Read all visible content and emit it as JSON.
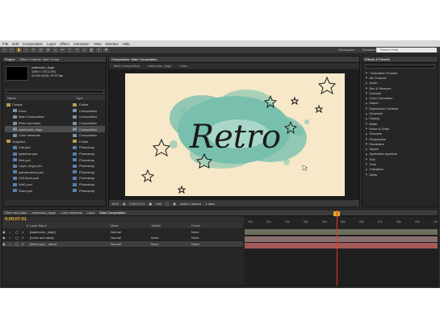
{
  "menu": [
    "File",
    "Edit",
    "Composition",
    "Layer",
    "Effect",
    "Animation",
    "View",
    "Window",
    "Help"
  ],
  "toolbar": {
    "workspace_label": "Workspace:",
    "workspace_value": "Standard",
    "search_placeholder": "Search Help"
  },
  "project_panel": {
    "tabs": [
      "Project",
      "Effect Controls: Main Comp"
    ],
    "item_info": {
      "name": "watercolor_large",
      "line2": "1280 x 720 (1.00)",
      "line3": "Δ 0;00;10;00, 29.97 fps"
    },
    "columns": {
      "name": "Name",
      "type": "Type"
    },
    "items": [
      {
        "name": "Comps",
        "type": "Folder",
        "kind": "folder",
        "label_color": "#b99c4a"
      },
      {
        "name": "Lines",
        "type": "Composition",
        "kind": "comp",
        "label_color": "#7b8fa3"
      },
      {
        "name": "Main Composition",
        "type": "Composition",
        "kind": "comp",
        "label_color": "#7b8fa3"
      },
      {
        "name": "Retro and stars",
        "type": "Composition",
        "kind": "comp",
        "label_color": "#7b8fa3"
      },
      {
        "name": "watercolor_large",
        "type": "Composition",
        "kind": "comp",
        "label_color": "#7b8fa3",
        "selected": true
      },
      {
        "name": "Color elements",
        "type": "Composition",
        "kind": "comp",
        "label_color": "#7b8fa3"
      },
      {
        "name": "Graphics",
        "type": "Folder",
        "kind": "folder",
        "label_color": "#b99c4a"
      },
      {
        "name": "Cell.psd",
        "type": "Photoshop",
        "kind": "file",
        "label_color": "#5a7fb0"
      },
      {
        "name": "splashes.psd",
        "type": "Photoshop",
        "kind": "file",
        "label_color": "#5a7fb0"
      },
      {
        "name": "Wet.psd",
        "type": "Photoshop",
        "kind": "file",
        "label_color": "#5a7fb0"
      },
      {
        "name": "Layer_large.psd",
        "type": "Photoshop",
        "kind": "file",
        "label_color": "#5a7fb0"
      },
      {
        "name": "paintbrushed.psd",
        "type": "Photoshop",
        "kind": "file",
        "label_color": "#5a7fb0"
      },
      {
        "name": "Cell blues.psd",
        "type": "Photoshop",
        "kind": "file",
        "label_color": "#5a7fb0"
      },
      {
        "name": "Wet1.psd",
        "type": "Photoshop",
        "kind": "file",
        "label_color": "#5a7fb0"
      },
      {
        "name": "Stars.psd",
        "type": "Photoshop",
        "kind": "file",
        "label_color": "#5a7fb0"
      }
    ]
  },
  "composition_panel": {
    "tab": "Composition: Main Composition",
    "subtabs": [
      "Main Composition",
      "watercolor_large",
      "Lines"
    ],
    "canvas_word": "Retro",
    "footer": {
      "zoom": "50%",
      "time": "0;00;07;01",
      "quality": "Half",
      "camera": "Active Camera",
      "views": "1 View"
    }
  },
  "effects_panel": {
    "tab": "Effects & Presets",
    "search_placeholder": "",
    "categories": [
      "* Animation Presets",
      "3D Channel",
      "Audio",
      "Blur & Sharpen",
      "Channel",
      "Color Correction",
      "Distort",
      "Expression Controls",
      "Generate",
      "Keying",
      "Matte",
      "Noise & Grain",
      "Obsolete",
      "Perspective",
      "Simulation",
      "Stylize",
      "Synthetics Aperture",
      "Text",
      "Time",
      "Transition",
      "Utility"
    ]
  },
  "timeline": {
    "tabs": [
      "Retro and stars",
      "watercolor_large",
      "Color elements",
      "Lines",
      "Main Composition"
    ],
    "timecode": "0;00;07;01",
    "columns": {
      "num": "#",
      "name": "Layer Name",
      "mode": "Mode",
      "trkmat": "TrkMat",
      "parent": "Parent"
    },
    "ruler_labels": [
      "00s",
      "01s",
      "02s",
      "03s",
      "04s",
      "05s",
      "06s",
      "07s",
      "08s",
      "09s",
      "10s"
    ],
    "layers": [
      {
        "num": "1",
        "name": "[watercolor_large]",
        "mode": "Normal",
        "trkmat": "",
        "parent": "None",
        "track_color": "#6b6f5c"
      },
      {
        "num": "2",
        "name": "[Lines and stars]",
        "mode": "Normal",
        "trkmat": "None",
        "parent": "None",
        "track_color": "#8a6e6e"
      },
      {
        "num": "3",
        "name": "[Retro.psd, ..stars]",
        "mode": "Normal",
        "trkmat": "None",
        "parent": "None",
        "track_color": "#a65a5a"
      }
    ]
  }
}
